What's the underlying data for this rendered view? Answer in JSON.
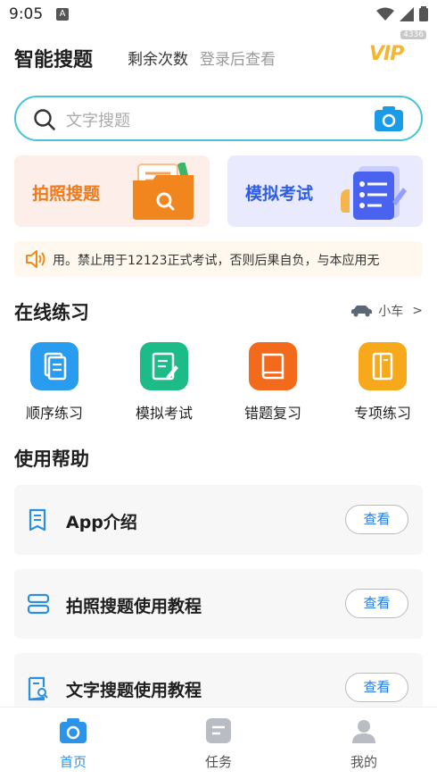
{
  "status": {
    "time": "9:05",
    "notification_letter": "A"
  },
  "header": {
    "title": "智能搜题",
    "remaining_label": "剩余次数",
    "login_hint": "登录后查看",
    "vip_label": "VIP",
    "vip_badge": "4336"
  },
  "search": {
    "placeholder": "文字搜题",
    "icon": "search-icon",
    "camera_icon": "camera-icon"
  },
  "cards": {
    "photo_label": "拍照搜题",
    "exam_label": "模拟考试"
  },
  "notice": {
    "text": "用。禁止用于12123正式考试，否则后果自负，与本应用无"
  },
  "practice": {
    "title": "在线练习",
    "car_label": "小车",
    "car_arrow": ">",
    "items": [
      {
        "label": "顺序练习",
        "color": "#2a9cf0"
      },
      {
        "label": "模拟考试",
        "color": "#1dbb87"
      },
      {
        "label": "错题复习",
        "color": "#f26a1b"
      },
      {
        "label": "专项练习",
        "color": "#f7a81b"
      }
    ]
  },
  "help": {
    "title": "使用帮助",
    "items": [
      {
        "label": "App介绍",
        "button": "查看"
      },
      {
        "label": "拍照搜题使用教程",
        "button": "查看"
      },
      {
        "label": "文字搜题使用教程",
        "button": "查看"
      }
    ]
  },
  "nav": {
    "items": [
      {
        "label": "首页",
        "active": true
      },
      {
        "label": "任务",
        "active": false
      },
      {
        "label": "我的",
        "active": false
      }
    ],
    "active_color": "#2c94e8"
  }
}
